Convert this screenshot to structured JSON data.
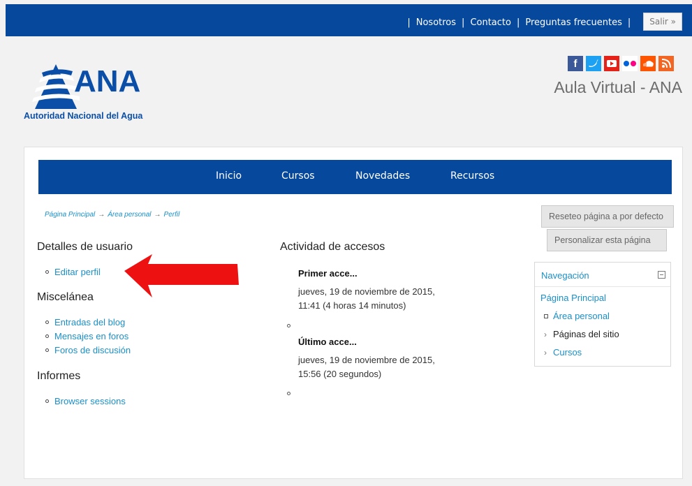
{
  "topbar": {
    "links": [
      "Nosotros",
      "Contacto",
      "Preguntas frecuentes"
    ],
    "salir": "Salir »"
  },
  "header": {
    "logo_text": "ANA",
    "logo_sub": "Autoridad Nacional del Agua",
    "site_title": "Aula Virtual - ANA",
    "social": [
      {
        "icon": "facebook-icon",
        "glyph": "f",
        "color": "#3b5998"
      },
      {
        "icon": "twitter-icon",
        "glyph": "t",
        "color": "#1da1f2"
      },
      {
        "icon": "youtube-icon",
        "glyph": "▶",
        "color": "#e62117"
      },
      {
        "icon": "flickr-icon",
        "glyph": "••",
        "color": "#ffffff"
      },
      {
        "icon": "soundcloud-icon",
        "glyph": "☁",
        "color": "#ff5500"
      },
      {
        "icon": "rss-icon",
        "glyph": "))",
        "color": "#f26522"
      }
    ]
  },
  "nav": {
    "items": [
      "Inicio",
      "Cursos",
      "Novedades",
      "Recursos"
    ]
  },
  "breadcrumb": [
    "Página Principal",
    "Área personal",
    "Perfil"
  ],
  "left": {
    "user_details_heading": "Detalles de usuario",
    "edit_profile": "Editar perfil",
    "misc_heading": "Miscelánea",
    "misc_links": [
      "Entradas del blog",
      "Mensajes en foros",
      "Foros de discusión"
    ],
    "reports_heading": "Informes",
    "reports_links": [
      "Browser sessions"
    ]
  },
  "activity": {
    "heading": "Actividad de accesos",
    "first_title": "Primer acce...",
    "first_line1": "jueves, 19 de noviembre de 2015,",
    "first_line2": "11:41  (4 horas 14 minutos)",
    "last_title": "Último acce...",
    "last_line1": "jueves, 19 de noviembre de 2015,",
    "last_line2": "15:56  (20 segundos)"
  },
  "buttons": {
    "reset": "Reseteo página a por defecto",
    "customize": "Personalizar esta página"
  },
  "navblock": {
    "title": "Navegación",
    "home": "Página Principal",
    "personal": "Área personal",
    "site_pages": "Páginas del sitio",
    "courses": "Cursos"
  },
  "colors": {
    "brand_blue": "#06489b",
    "link_blue": "#1a8fc7",
    "annotation_red": "#ee1111"
  }
}
